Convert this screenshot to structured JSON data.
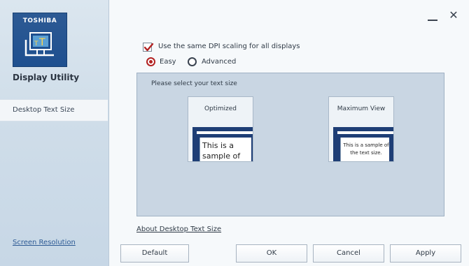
{
  "sidebar": {
    "brand": "TOSHIBA",
    "logo_icon": "text-size-monitor-icon",
    "app_title": "Display Utility",
    "nav_items": [
      {
        "label": "Desktop Text Size",
        "selected": true
      }
    ],
    "footer_link": "Screen Resolution"
  },
  "window_controls": {
    "minimize_icon": "minimize-icon",
    "close_icon": "close-icon",
    "close_glyph": "✕"
  },
  "options": {
    "same_dpi_label": "Use the same DPI scaling for all displays",
    "same_dpi_checked": true,
    "modes": [
      {
        "label": "Easy",
        "selected": true
      },
      {
        "label": "Advanced",
        "selected": false
      }
    ]
  },
  "panel": {
    "title": "Please select your text size",
    "cards": [
      {
        "label": "Optimized",
        "sample": "This is a sample of"
      },
      {
        "label": "Maximum View",
        "sample": "This is a sample of the text size."
      }
    ]
  },
  "about_link": "About Desktop Text Size",
  "buttons": {
    "default": "Default",
    "ok": "OK",
    "cancel": "Cancel",
    "apply": "Apply"
  },
  "colors": {
    "accent_red": "#b22222",
    "brand_blue": "#1e4f8f",
    "panel_bg": "#c9d6e3"
  }
}
